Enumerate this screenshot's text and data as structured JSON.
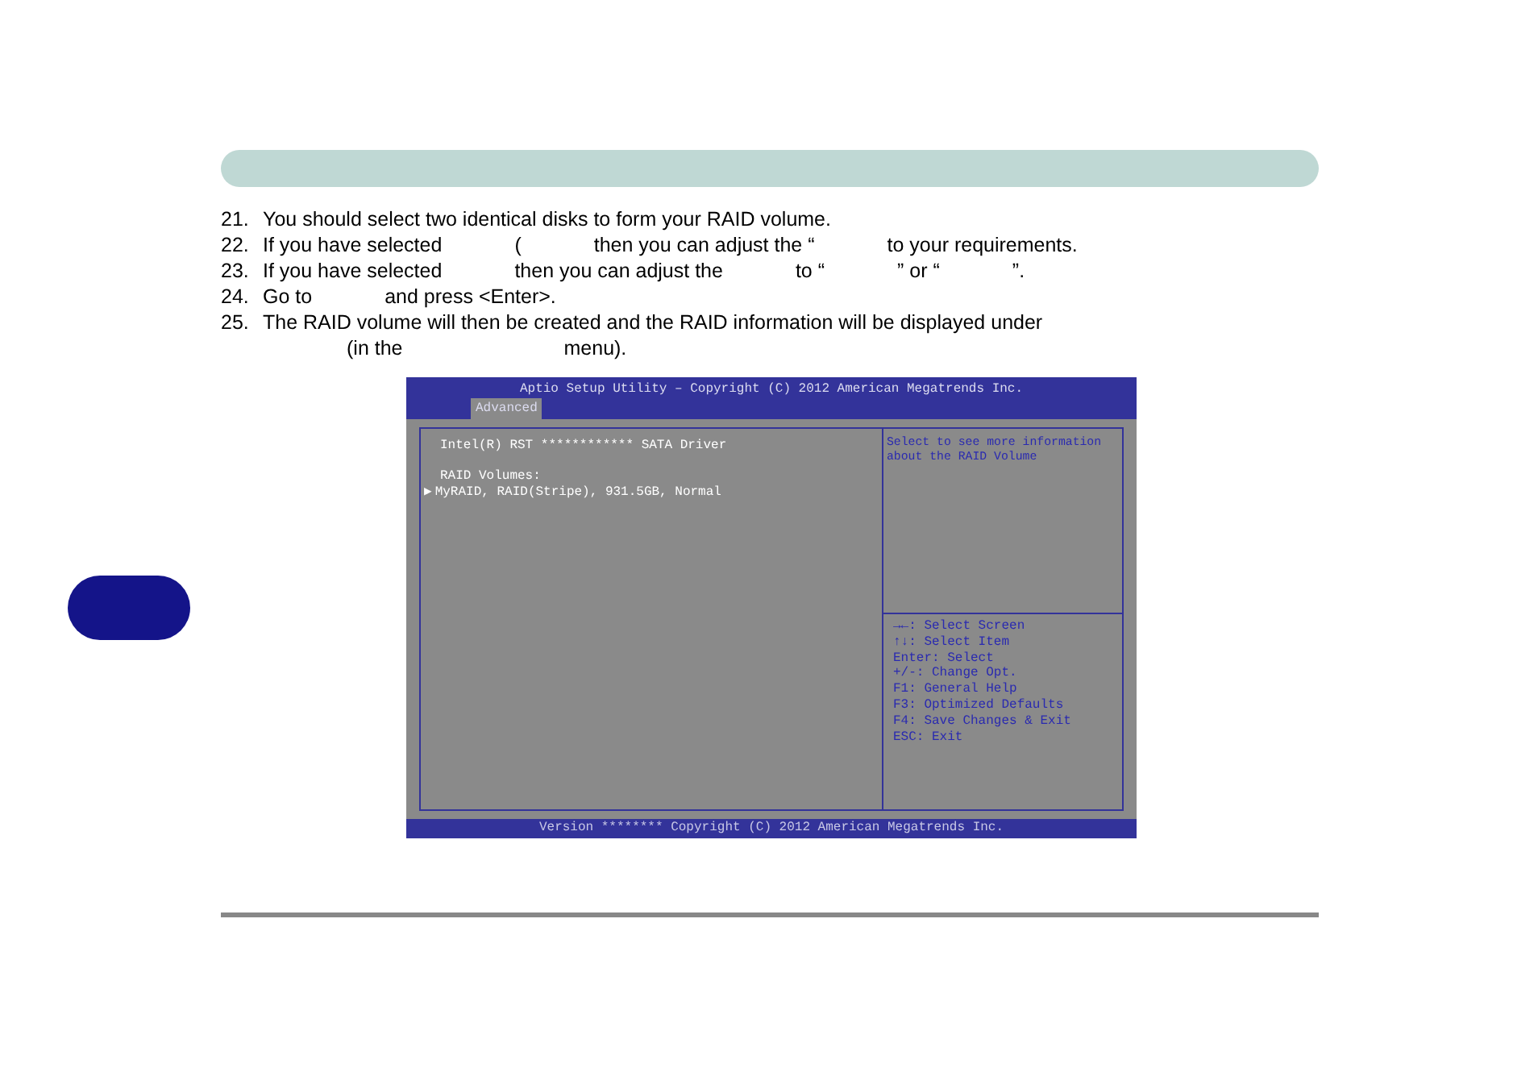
{
  "steps": [
    {
      "number": "21.",
      "parts": [
        "You should select two identical disks to form your RAID volume."
      ]
    },
    {
      "number": "22.",
      "parts": [
        "If you have selected",
        "(",
        "then you can adjust the “",
        "to your requirements."
      ]
    },
    {
      "number": "23.",
      "parts": [
        "If you have selected",
        "then you can adjust the",
        "to “",
        "” or “",
        "”."
      ]
    },
    {
      "number": "24.",
      "parts": [
        "Go to",
        "and press <Enter>."
      ]
    },
    {
      "number": "25.",
      "parts": [
        "The RAID volume will then be created and the RAID information will be displayed under"
      ]
    },
    {
      "parts": [
        "(in the",
        "menu)."
      ]
    }
  ],
  "bios": {
    "title": "Aptio Setup Utility – Copyright (C) 2012 American Megatrends Inc.",
    "tabs": [
      {
        "label": "Advanced",
        "selected": true
      }
    ],
    "driver": "Intel(R) RST ************ SATA Driver",
    "volumes_label": "RAID Volumes:",
    "volumes": [
      {
        "marker": "▶",
        "label": "MyRAID, RAID(Stripe), 931.5GB, Normal"
      }
    ],
    "help": "Select to see more information about the RAID Volume",
    "keys": [
      "→←: Select Screen",
      "↑↓: Select Item",
      "Enter: Select",
      "+/-: Change Opt.",
      "F1: General Help",
      "F3: Optimized Defaults",
      "F4: Save Changes & Exit",
      "ESC: Exit"
    ],
    "footer": "Version ******** Copyright (C) 2012 American Megatrends Inc."
  }
}
